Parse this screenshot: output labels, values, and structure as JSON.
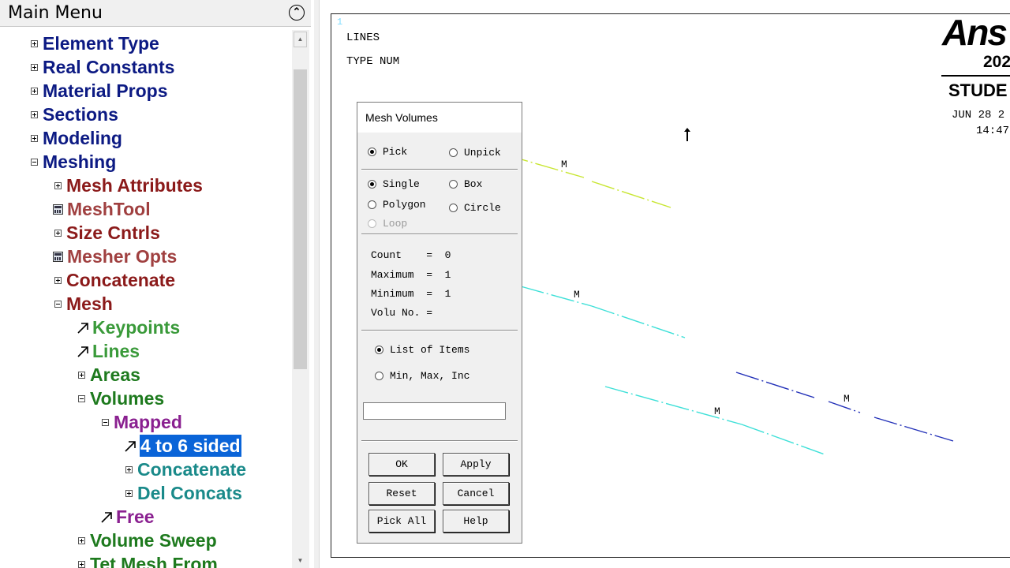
{
  "main_menu": {
    "title": "Main Menu",
    "items": [
      {
        "label": "Element Type",
        "color": "#0c1a83"
      },
      {
        "label": "Real Constants",
        "color": "#0c1a83"
      },
      {
        "label": "Material Props",
        "color": "#0c1a83"
      },
      {
        "label": "Sections",
        "color": "#0c1a83"
      },
      {
        "label": "Modeling",
        "color": "#0c1a83"
      },
      {
        "label": "Meshing",
        "color": "#0c1a83"
      },
      {
        "label": "Mesh Attributes",
        "color": "#8b1a1a"
      },
      {
        "label": "MeshTool",
        "color": "#a04040"
      },
      {
        "label": "Size Cntrls",
        "color": "#8b1a1a"
      },
      {
        "label": "Mesher Opts",
        "color": "#a04040"
      },
      {
        "label": "Concatenate",
        "color": "#8b1a1a"
      },
      {
        "label": "Mesh",
        "color": "#8b1a1a"
      },
      {
        "label": "Keypoints",
        "color": "#3a9a3a"
      },
      {
        "label": "Lines",
        "color": "#3a9a3a"
      },
      {
        "label": "Areas",
        "color": "#1e7a1e"
      },
      {
        "label": "Volumes",
        "color": "#1e7a1e"
      },
      {
        "label": "Mapped",
        "color": "#8a2090"
      },
      {
        "label": "4 to 6 sided",
        "color": "#ffffff"
      },
      {
        "label": "Concatenate",
        "color": "#1a8a8a"
      },
      {
        "label": "Del Concats",
        "color": "#1a8a8a"
      },
      {
        "label": "Free",
        "color": "#8a2090"
      },
      {
        "label": "Volume Sweep",
        "color": "#1e7a1e"
      },
      {
        "label": "Tet Mesh From",
        "color": "#1e7a1e"
      }
    ]
  },
  "graphics": {
    "window_number": "1",
    "plot_label": "LINES",
    "type_label": "TYPE NUM",
    "mesh_marker": "M",
    "logo": "Ans",
    "logo_year": "202",
    "logo_edition": "STUDE",
    "date": "JUN 28 2",
    "time": "14:47",
    "line_colors": [
      "#c8e632",
      "#3ee0d8",
      "#2230b8"
    ]
  },
  "dialog": {
    "title": "Mesh Volumes",
    "pick": "Pick",
    "unpick": "Unpick",
    "single": "Single",
    "box": "Box",
    "polygon": "Polygon",
    "circle": "Circle",
    "loop": "Loop",
    "count": "Count    =  0",
    "maximum": "Maximum  =  1",
    "minimum": "Minimum  =  1",
    "volu_no": "Volu No. =",
    "list_of_items": "List of Items",
    "min_max_inc": "Min, Max, Inc",
    "input_value": "",
    "ok": "OK",
    "apply": "Apply",
    "reset": "Reset",
    "cancel": "Cancel",
    "pick_all": "Pick All",
    "help": "Help"
  }
}
